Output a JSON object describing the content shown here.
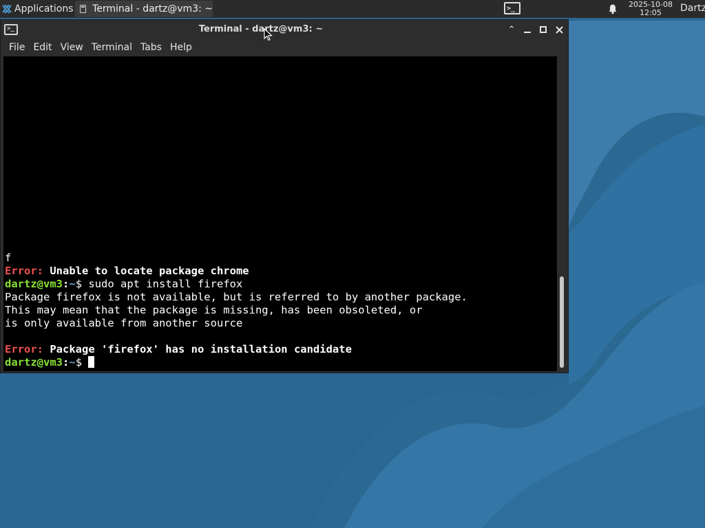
{
  "panel": {
    "apps_label": "Applications",
    "apps_sep": "⋮",
    "task_label": "Terminal - dartz@vm3: ~",
    "clock_date": "2025-10-08",
    "clock_time": "12:05",
    "user": "Dartz"
  },
  "window": {
    "title": "Terminal - dartz@vm3: ~",
    "icon_glyph": ">_",
    "menu": [
      "File",
      "Edit",
      "View",
      "Terminal",
      "Tabs",
      "Help"
    ]
  },
  "terminal": {
    "line1": "f",
    "line2_err": "Error:",
    "line2_msg": " Unable to locate package chrome",
    "prompt_user": "dartz@vm3",
    "prompt_sep": ":",
    "prompt_path": "~",
    "prompt_end": "$ ",
    "line3_cmd": "sudo apt install firefox",
    "line4": "Package firefox is not available, but is referred to by another package.",
    "line5": "This may mean that the package is missing, has been obsoleted, or",
    "line6": "is only available from another source",
    "line8_err": "Error:",
    "line8_msg": " Package 'firefox' has no installation candidate"
  },
  "colors": {
    "desktop": "#2f6e99",
    "error": "#ef5350",
    "prompt_user": "#8ae234",
    "prompt_path": "#729fcf"
  }
}
